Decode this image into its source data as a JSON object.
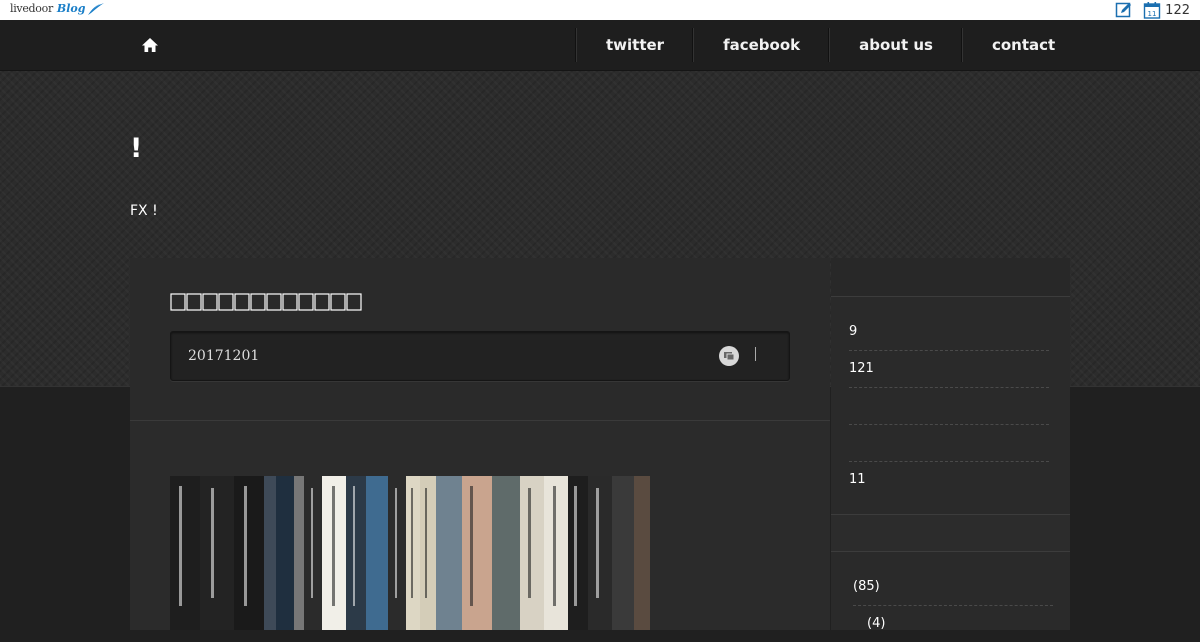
{
  "topbar": {
    "logo_text": "livedoor",
    "logo_suffix": "Blog",
    "edit_icon": "pencil-icon",
    "calendar_icon": "calendar-icon",
    "calendar_day": "11",
    "count": "122"
  },
  "nav": {
    "home_icon": "home-icon",
    "items": [
      {
        "label": "twitter"
      },
      {
        "label": "facebook"
      },
      {
        "label": "about us"
      },
      {
        "label": "contact"
      }
    ]
  },
  "site": {
    "title": "!",
    "description": "FX !"
  },
  "article": {
    "title": "",
    "date": "20171201",
    "comment_icon": "comment-icon",
    "separator": "|"
  },
  "sidebar": {
    "items": [
      {
        "label": "9"
      },
      {
        "label": "121"
      },
      {
        "label": ""
      },
      {
        "label": ""
      },
      {
        "label": "11"
      }
    ],
    "categories": [
      {
        "label": "(85)"
      },
      {
        "label": "(4)"
      }
    ]
  }
}
